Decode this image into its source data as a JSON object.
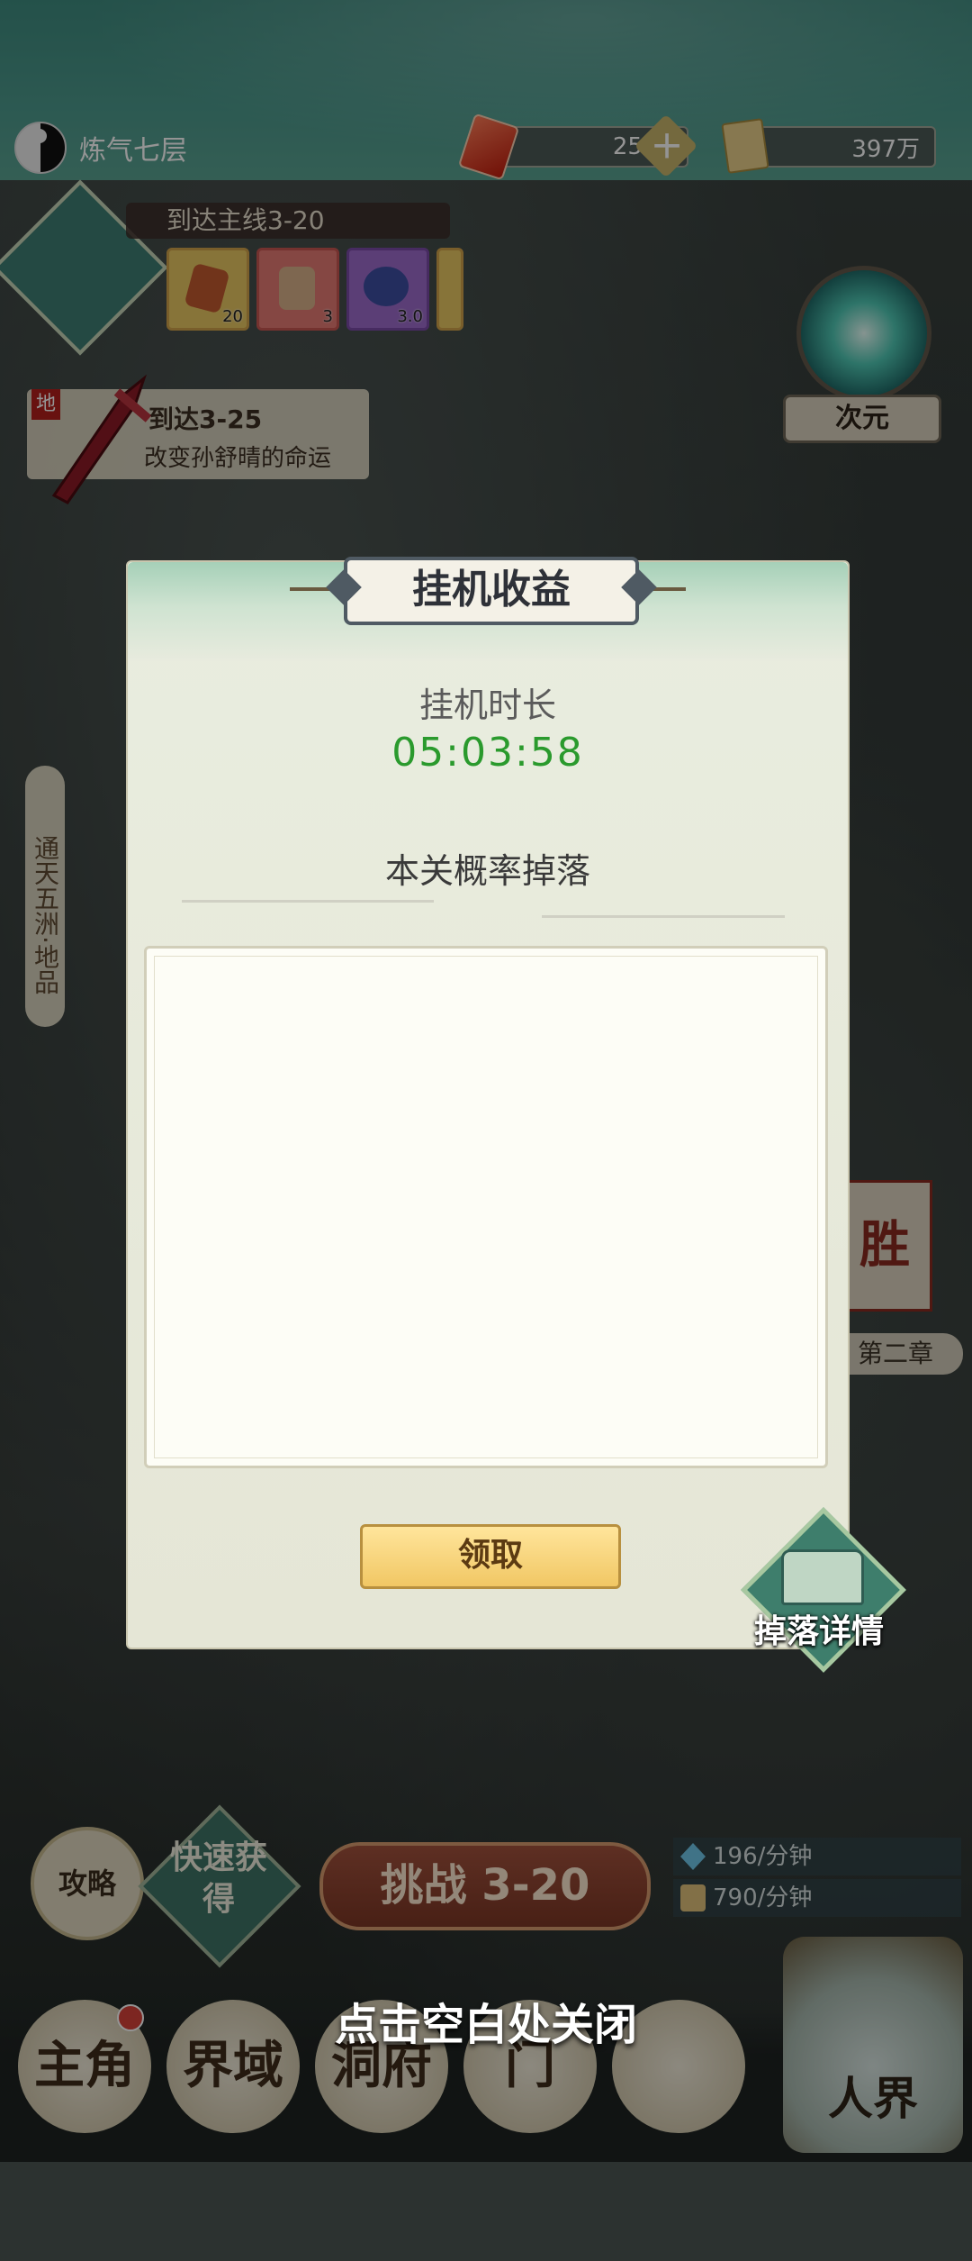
{
  "topbar": {
    "realm_label": "炼气七层",
    "spirit_stone_amount": "2532",
    "scroll_amount": "397万"
  },
  "quest": {
    "title": "到达主线3-20",
    "rewards": [
      {
        "name": "stone-shard",
        "count": "20"
      },
      {
        "name": "talisman",
        "count": "3"
      },
      {
        "name": "blue-orb",
        "count": "3.0"
      }
    ]
  },
  "task": {
    "tag": "地",
    "title": "到达3-25",
    "subtitle": "改变孙舒晴的命运"
  },
  "portal": {
    "label": "次元"
  },
  "region": {
    "label": "通天五洲·地品"
  },
  "victory": {
    "label": "胜",
    "chapter": "第二章"
  },
  "dialog": {
    "title": "挂机收益",
    "duration_label": "挂机时长",
    "duration_value": "05:03:58",
    "drops_label": "本关概率掉落",
    "claim_label": "领取",
    "drop_details_label": "掉落详情"
  },
  "hud": {
    "strategy_label": "攻略",
    "quick_gain_label": "快速获得",
    "challenge_label": "挑战 3-20",
    "rate_1": "196/分钟",
    "rate_2": "790/分钟"
  },
  "nav": {
    "items": [
      "主角",
      "界域",
      "洞府",
      "门",
      "人界"
    ]
  },
  "close_tip": "点击空白处关闭",
  "colors": {
    "timer_green": "#2a9a2d",
    "claim_gold": "#f1c764",
    "header_teal": "#4d9a8d"
  }
}
